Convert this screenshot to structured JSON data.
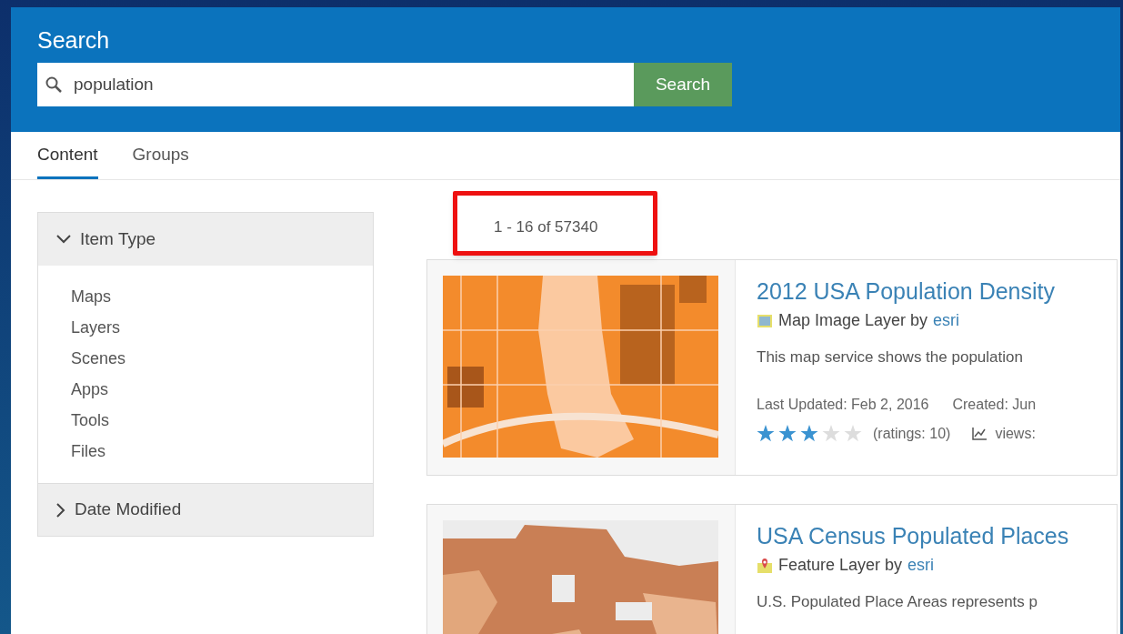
{
  "header": {
    "title": "Search",
    "search_value": "population",
    "button": "Search"
  },
  "tabs": [
    {
      "label": "Content",
      "selected": true
    },
    {
      "label": "Groups",
      "selected": false
    }
  ],
  "filters": [
    {
      "label": "Item Type",
      "expanded": true,
      "options": [
        "Maps",
        "Layers",
        "Scenes",
        "Apps",
        "Tools",
        "Files"
      ]
    },
    {
      "label": "Date Modified",
      "expanded": false
    }
  ],
  "results_count": {
    "text": "1 - 16 of 57340",
    "highlighted": true
  },
  "results": [
    {
      "kind": "map-image",
      "title": "2012 USA Population Density",
      "type": "Map Image Layer",
      "by": "by",
      "owner": "esri",
      "description": "This map service shows the population",
      "last_updated": "Last Updated: Feb 2, 2016",
      "created": "Created: Jun",
      "stars": 3,
      "ratings": "(ratings: 10)",
      "views": "views:"
    },
    {
      "kind": "feature",
      "title": "USA Census Populated Places",
      "type": "Feature Layer",
      "by": "by",
      "owner": "esri",
      "description": "U.S. Populated Place Areas represents p"
    }
  ]
}
